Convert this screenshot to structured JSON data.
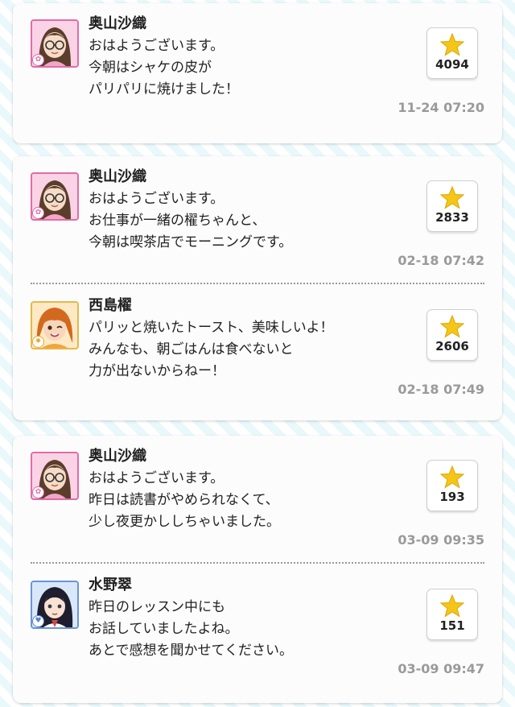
{
  "colors": {
    "star": "#f5c518",
    "timestamp": "#9a9a9a",
    "cute_border": "#e06ca6",
    "passion_border": "#e6b84a",
    "cool_border": "#6a95d6"
  },
  "icons": {
    "like": "star-icon",
    "avatar": "avatar-icon"
  },
  "cards": [
    {
      "posts": [
        {
          "name": "奥山沙織",
          "lines": [
            "おはようございます。",
            "今朝はシャケの皮が",
            "パリパリに焼けました！"
          ],
          "likes": "4094",
          "time": "11-24 07:20"
        }
      ]
    },
    {
      "posts": [
        {
          "name": "奥山沙織",
          "lines": [
            "おはようございます。",
            "お仕事が一緒の櫂ちゃんと、",
            "今朝は喫茶店でモーニングです。"
          ],
          "likes": "2833",
          "time": "02-18 07:42"
        },
        {
          "name": "西島櫂",
          "lines": [
            "パリッと焼いたトースト、美味しいよ！",
            "みんなも、朝ごはんは食べないと",
            "力が出ないからねー！"
          ],
          "likes": "2606",
          "time": "02-18 07:49"
        }
      ]
    },
    {
      "posts": [
        {
          "name": "奥山沙織",
          "lines": [
            "おはようございます。",
            "昨日は読書がやめられなくて、",
            "少し夜更かししちゃいました。"
          ],
          "likes": "193",
          "time": "03-09 09:35"
        },
        {
          "name": "水野翠",
          "lines": [
            "昨日のレッスン中にも",
            "お話していましたよね。",
            "あとで感想を聞かせてください。"
          ],
          "likes": "151",
          "time": "03-09 09:47"
        }
      ]
    }
  ]
}
